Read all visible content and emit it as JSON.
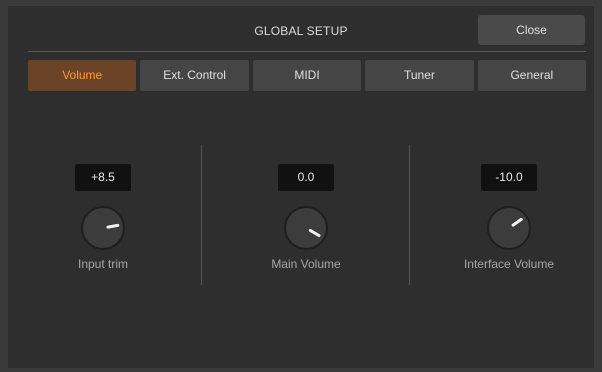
{
  "header": {
    "title": "GLOBAL SETUP",
    "close_label": "Close"
  },
  "tabs": [
    {
      "label": "Volume",
      "active": true
    },
    {
      "label": "Ext. Control",
      "active": false
    },
    {
      "label": "MIDI",
      "active": false
    },
    {
      "label": "Tuner",
      "active": false
    },
    {
      "label": "General",
      "active": false
    }
  ],
  "knobs": [
    {
      "id": "input-trim",
      "value": "+8.5",
      "label": "Input trim",
      "indicator_angle_deg": -10
    },
    {
      "id": "main-volume",
      "value": "0.0",
      "label": "Main Volume",
      "indicator_angle_deg": 30
    },
    {
      "id": "interface-volume",
      "value": "-10.0",
      "label": "Interface Volume",
      "indicator_angle_deg": -35
    }
  ],
  "colors": {
    "accent": "#ff9a3c",
    "active_tab_bg": "#6a4326",
    "panel_bg": "#2e2e2e",
    "knob_body": "#3c3c3c",
    "knob_indicator": "#f2f2f2"
  }
}
